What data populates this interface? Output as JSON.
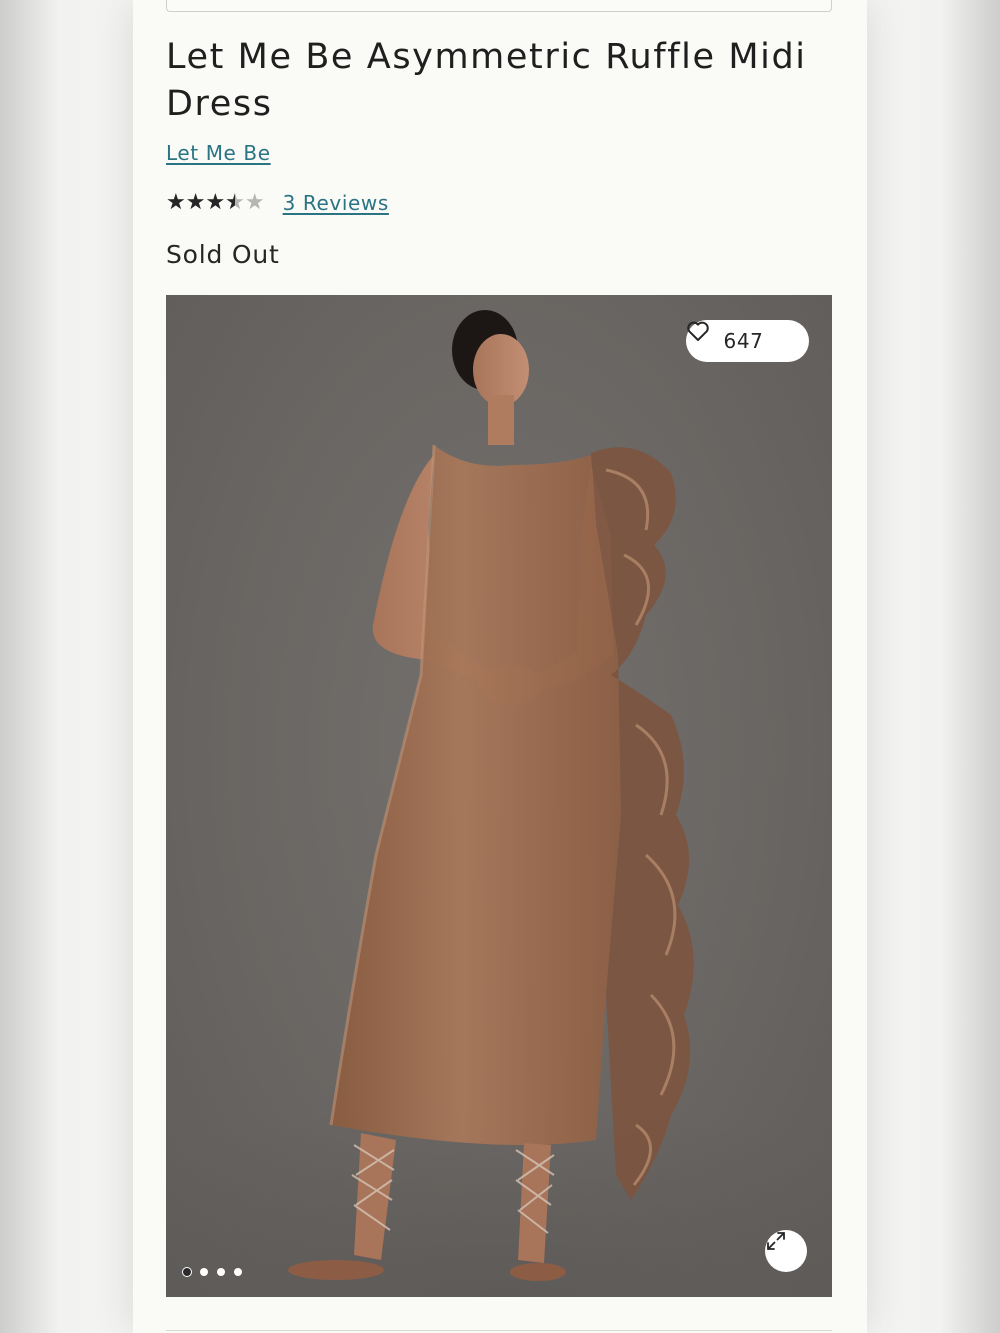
{
  "product": {
    "title": "Let Me Be Asymmetric Ruffle Midi Dress",
    "brand": "Let Me Be",
    "rating": 3.5,
    "rating_max": 5,
    "stars_glyphs": "★★★★★",
    "reviews_label": "3 Reviews",
    "availability": "Sold Out"
  },
  "gallery": {
    "image_name": "model wearing brown organza asymmetric ruffle midi dress",
    "like_count": "647",
    "like_icon": "heart-icon",
    "expand_icon": "expand-icon",
    "slide_count": 4,
    "active_slide": 1
  },
  "colors": {
    "link": "#2a7484",
    "text": "#1f1f1f",
    "background": "#fafaf7",
    "photo_backdrop": "#6a6663",
    "dress": "#9a6b4c"
  }
}
